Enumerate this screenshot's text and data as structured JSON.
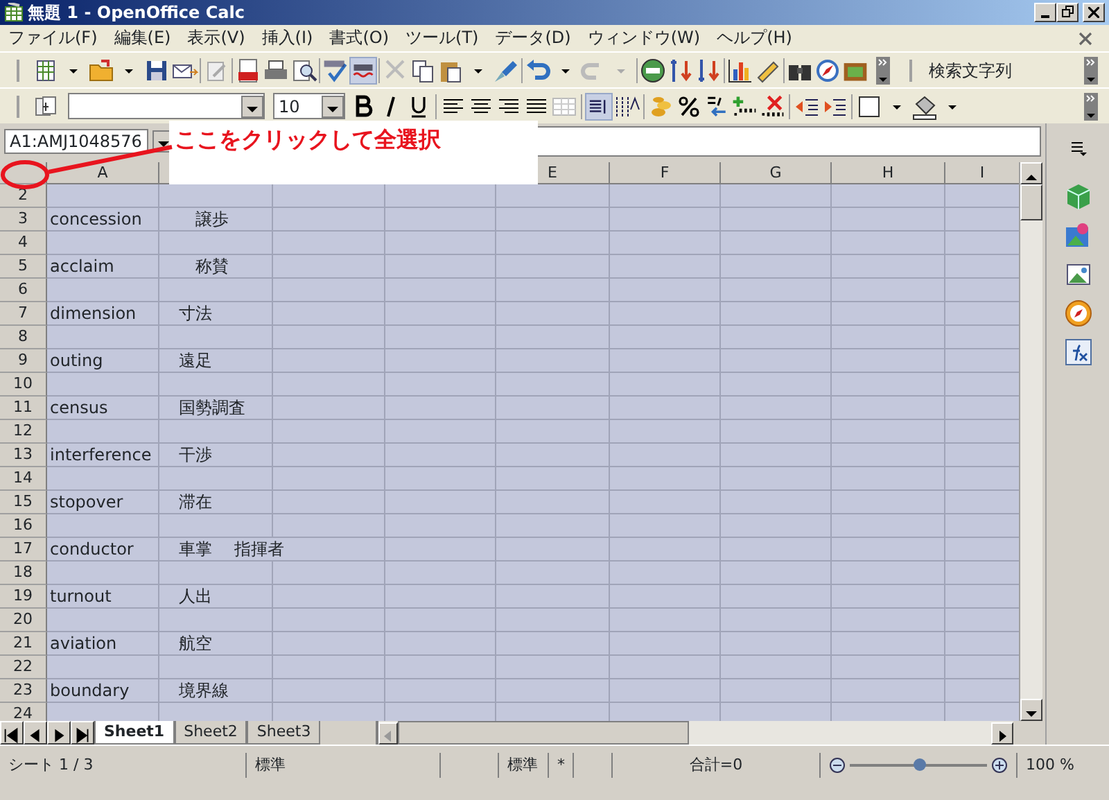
{
  "window": {
    "title": "無題 1 - OpenOffice Calc"
  },
  "menu": [
    "ファイル(F)",
    "編集(E)",
    "表示(V)",
    "挿入(I)",
    "書式(O)",
    "ツール(T)",
    "データ(D)",
    "ウィンドウ(W)",
    "ヘルプ(H)"
  ],
  "toolbar": {
    "auto_spellcheck": {
      "pressed": true
    },
    "search_placeholder": "検索文字列"
  },
  "formatting": {
    "font_size": "10",
    "wrap_text": {
      "pressed": true
    }
  },
  "name_box": "A1:AMJ1048576",
  "callout": "ここをクリックして全選択",
  "columns": [
    {
      "header": "A"
    },
    {},
    {},
    {},
    {
      "header": "E"
    },
    {
      "header": "F"
    },
    {
      "header": "G"
    },
    {
      "header": "H"
    },
    {
      "header": "I"
    }
  ],
  "rows": [
    {
      "number": "2",
      "cells": []
    },
    {
      "number": "3",
      "cells": [
        "concession",
        "　譲歩"
      ]
    },
    {
      "number": "4",
      "cells": []
    },
    {
      "number": "5",
      "cells": [
        "acclaim",
        "　称賛"
      ]
    },
    {
      "number": "6",
      "cells": []
    },
    {
      "number": "7",
      "cells": [
        "dimension",
        "寸法"
      ]
    },
    {
      "number": "8",
      "cells": []
    },
    {
      "number": "9",
      "cells": [
        "outing",
        "遠足"
      ]
    },
    {
      "number": "10",
      "cells": []
    },
    {
      "number": "11",
      "cells": [
        "census",
        "国勢調査"
      ]
    },
    {
      "number": "12",
      "cells": []
    },
    {
      "number": "13",
      "cells": [
        "interference",
        "干渉"
      ]
    },
    {
      "number": "14",
      "cells": []
    },
    {
      "number": "15",
      "cells": [
        "stopover",
        "滞在"
      ]
    },
    {
      "number": "16",
      "cells": []
    },
    {
      "number": "17",
      "cells": [
        "conductor",
        "車掌　 指揮者"
      ]
    },
    {
      "number": "18",
      "cells": []
    },
    {
      "number": "19",
      "cells": [
        "turnout",
        "人出"
      ]
    },
    {
      "number": "20",
      "cells": []
    },
    {
      "number": "21",
      "cells": [
        "aviation",
        "航空"
      ]
    },
    {
      "number": "22",
      "cells": []
    },
    {
      "number": "23",
      "cells": [
        "boundary",
        "境界線"
      ]
    },
    {
      "number": "24",
      "cells": []
    }
  ],
  "sheet_tabs": [
    {
      "label": "Sheet1",
      "selected": true
    },
    {
      "label": "Sheet2",
      "selected": false
    },
    {
      "label": "Sheet3",
      "selected": false
    }
  ],
  "status_bar": {
    "sheet": "シート 1 / 3",
    "page_style": "標準",
    "mode": "標準",
    "modified": "*",
    "sum": "合計=0",
    "zoom": {
      "level": 0.5
    },
    "zoom_percent": "100 %"
  }
}
